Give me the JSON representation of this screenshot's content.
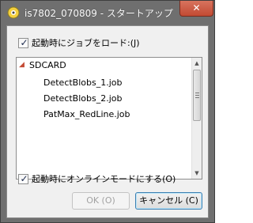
{
  "window": {
    "title": "is7802_070809 - スタートアップ",
    "close_label": "✕"
  },
  "load_job_checkbox": {
    "label": "起動時にジョブをロード:(J)",
    "checked": true
  },
  "job_tree": {
    "root": "SDCARD",
    "items": [
      "DetectBlobs_1.job",
      "DetectBlobs_2.job",
      "PatMax_RedLine.job"
    ]
  },
  "online_checkbox": {
    "label": "起動時にオンラインモードにする(O)",
    "checked": true
  },
  "buttons": {
    "ok": "OK (O)",
    "cancel": "キャンセル (C)"
  },
  "icons": {
    "app": "cognex-app-icon",
    "expand": "expanded-triangle-icon",
    "check": "check-mark-icon"
  },
  "colors": {
    "titlebar": "#6f6f6f",
    "close_button": "#c24a33",
    "dialog_bg": "#f0f0f0",
    "default_button_border": "#3c7fb1"
  }
}
